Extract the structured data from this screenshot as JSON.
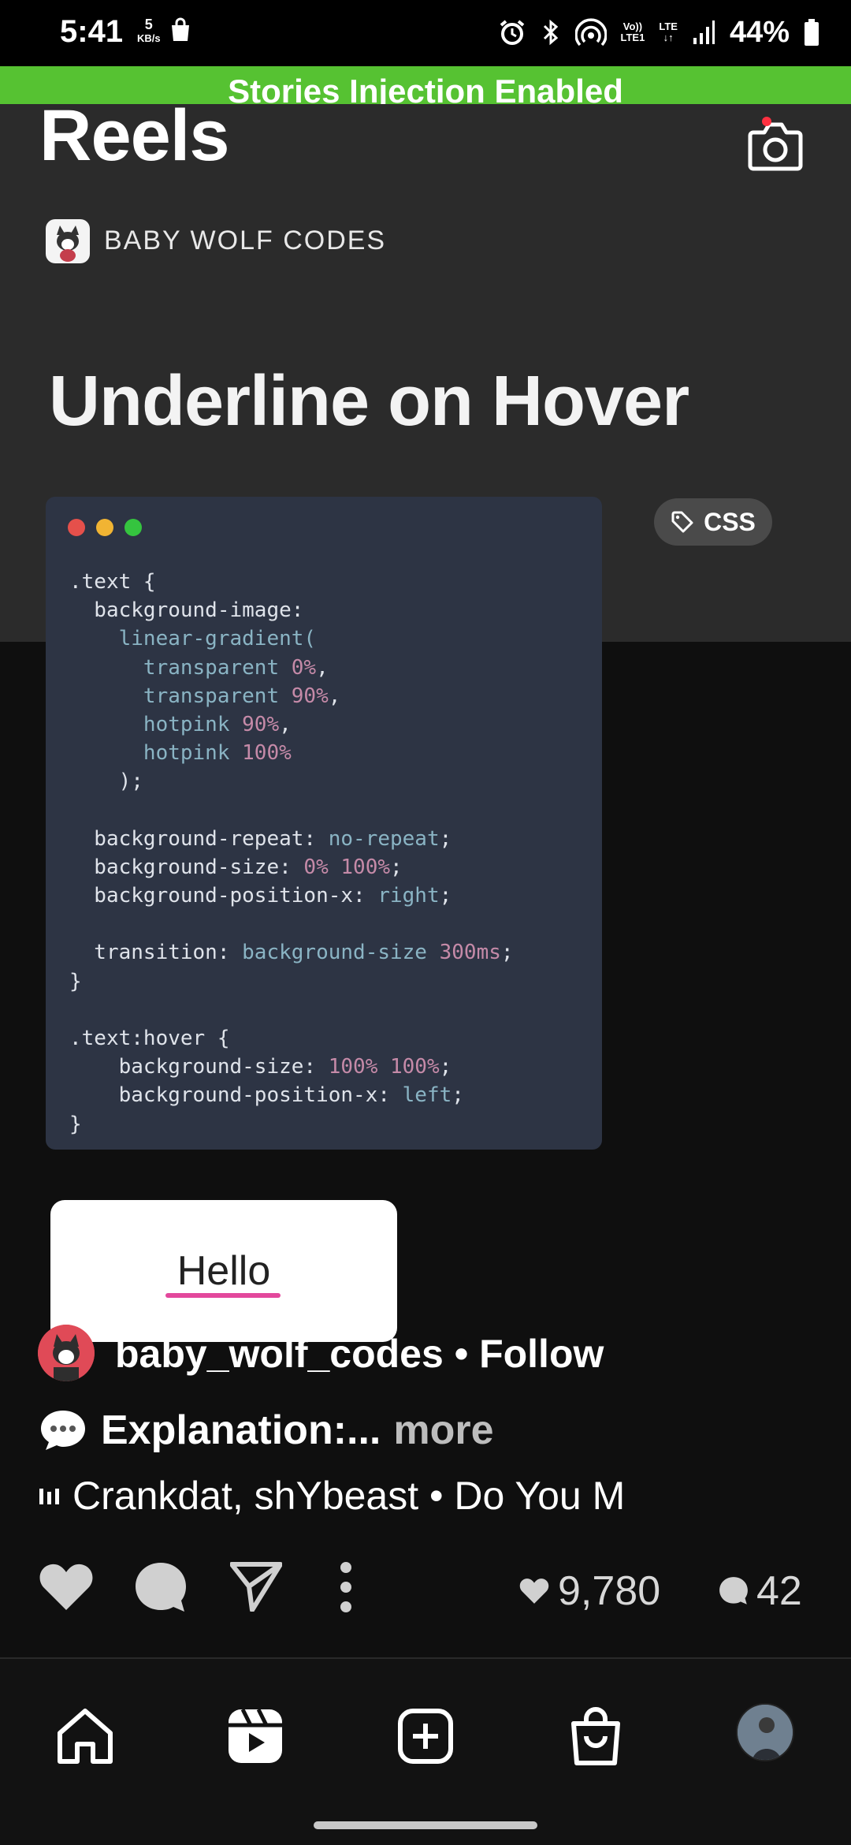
{
  "status_bar": {
    "time": "5:41",
    "net_speed_value": "5",
    "net_speed_unit": "KB/s",
    "volte": "Vo))",
    "lte_top": "LTE",
    "lte_bottom": "LTE1",
    "battery_percent": "44%"
  },
  "banner": {
    "text": "Stories Injection Enabled",
    "color": "#56c232"
  },
  "header": {
    "title": "Reels"
  },
  "video": {
    "brand": "BABY WOLF CODES",
    "heading": "Underline on Hover",
    "tag": "CSS",
    "window_dots": [
      "#e5504b",
      "#f1b433",
      "#35c43f"
    ],
    "code_lines": [
      [
        {
          "t": ".text {",
          "c": ""
        }
      ],
      [
        {
          "t": "  background-image:",
          "c": ""
        }
      ],
      [
        {
          "t": "    linear-gradient(",
          "c": "v"
        }
      ],
      [
        {
          "t": "      transparent ",
          "c": "v"
        },
        {
          "t": "0%",
          "c": "n"
        },
        {
          "t": ",",
          "c": ""
        }
      ],
      [
        {
          "t": "      transparent ",
          "c": "v"
        },
        {
          "t": "90%",
          "c": "n"
        },
        {
          "t": ",",
          "c": ""
        }
      ],
      [
        {
          "t": "      hotpink ",
          "c": "v"
        },
        {
          "t": "90%",
          "c": "n"
        },
        {
          "t": ",",
          "c": ""
        }
      ],
      [
        {
          "t": "      hotpink ",
          "c": "v"
        },
        {
          "t": "100%",
          "c": "n"
        }
      ],
      [
        {
          "t": "    );",
          "c": ""
        }
      ],
      [
        {
          "t": "",
          "c": ""
        }
      ],
      [
        {
          "t": "  background-repeat: ",
          "c": ""
        },
        {
          "t": "no-repeat",
          "c": "v"
        },
        {
          "t": ";",
          "c": ""
        }
      ],
      [
        {
          "t": "  background-size: ",
          "c": ""
        },
        {
          "t": "0% 100%",
          "c": "n"
        },
        {
          "t": ";",
          "c": ""
        }
      ],
      [
        {
          "t": "  background-position-x: ",
          "c": ""
        },
        {
          "t": "right",
          "c": "v"
        },
        {
          "t": ";",
          "c": ""
        }
      ],
      [
        {
          "t": "",
          "c": ""
        }
      ],
      [
        {
          "t": "  transition: ",
          "c": ""
        },
        {
          "t": "background-size ",
          "c": "v"
        },
        {
          "t": "300ms",
          "c": "n"
        },
        {
          "t": ";",
          "c": ""
        }
      ],
      [
        {
          "t": "}",
          "c": ""
        }
      ],
      [
        {
          "t": "",
          "c": ""
        }
      ],
      [
        {
          "t": ".text:hover {",
          "c": ""
        }
      ],
      [
        {
          "t": "    background-size: ",
          "c": ""
        },
        {
          "t": "100% 100%",
          "c": "n"
        },
        {
          "t": ";",
          "c": ""
        }
      ],
      [
        {
          "t": "    background-position-x: ",
          "c": ""
        },
        {
          "t": "left",
          "c": "v"
        },
        {
          "t": ";",
          "c": ""
        }
      ],
      [
        {
          "t": "}",
          "c": ""
        }
      ]
    ],
    "demo_text": "Hello",
    "demo_underline_color": "#e3489c"
  },
  "post": {
    "author_line": "baby_wolf_codes • Follow",
    "caption": "Explanation:...",
    "more": "more",
    "music": "Crankdat, shYbeast • Do You M",
    "likes": "9,780",
    "comments": "42"
  },
  "icons": {
    "camera": "camera-icon",
    "like": "heart-icon",
    "comment": "comment-icon",
    "share": "send-icon",
    "more": "more-vertical-icon",
    "home": "home-icon",
    "reels": "reels-icon",
    "create": "plus-square-icon",
    "shop": "shopping-bag-icon"
  }
}
